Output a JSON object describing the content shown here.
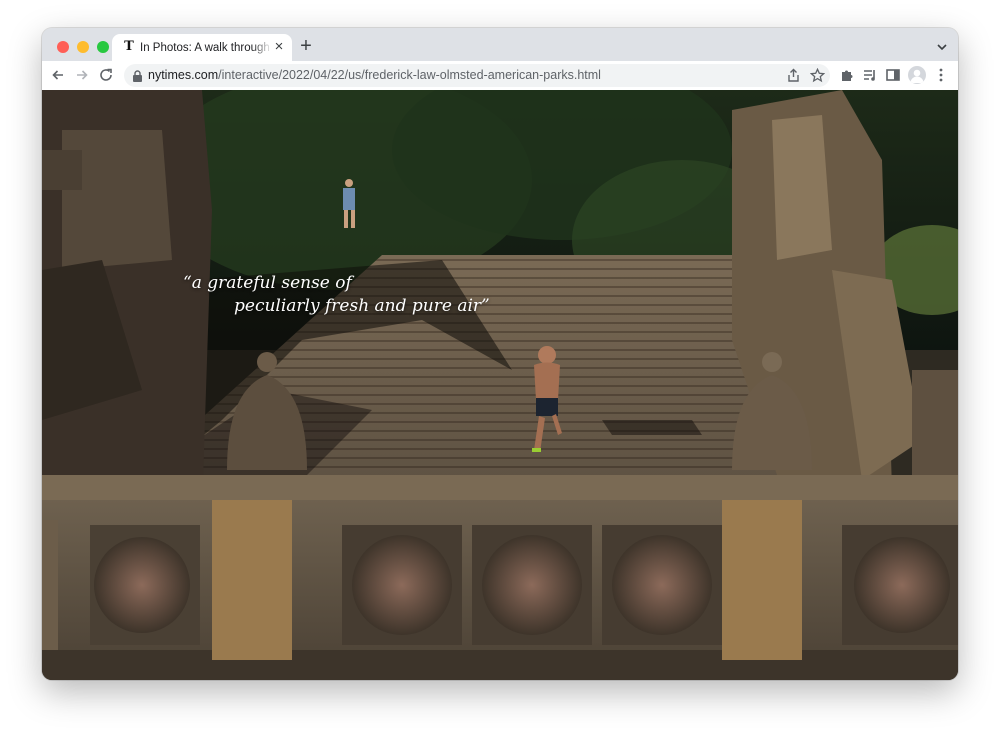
{
  "window": {
    "traffic_lights": {
      "close": "#ff5f57",
      "minimize": "#febc2e",
      "zoom": "#28c840"
    }
  },
  "tab": {
    "favicon": "T",
    "title": "In Photos: A walk through Frederick Law Olmsted's American Parks",
    "close_icon": "×",
    "new_tab_icon": "+"
  },
  "toolbar": {
    "url_host": "nytimes.com",
    "url_path": "/interactive/2022/04/22/us/frederick-law-olmsted-american-parks.html"
  },
  "content": {
    "quote_line1": "“a grateful sense of",
    "quote_line2": "peculiarly fresh and pure air”"
  },
  "icons": {
    "back": "arrow-left-icon",
    "forward": "arrow-right-icon",
    "reload": "reload-icon",
    "lock": "lock-icon",
    "share": "share-icon",
    "bookmark": "star-icon",
    "extensions": "puzzle-icon",
    "reading_list": "reading-list-icon",
    "side_panel": "side-panel-icon",
    "profile": "avatar-icon",
    "menu": "kebab-menu-icon",
    "tab_search": "chevron-down-icon"
  }
}
